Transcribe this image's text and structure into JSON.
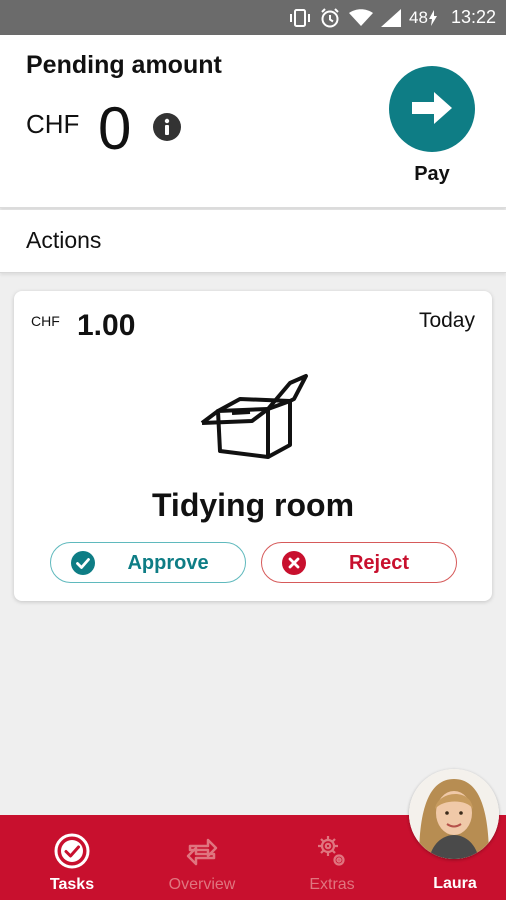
{
  "status_bar": {
    "battery": "48",
    "time": "13:22"
  },
  "header": {
    "title": "Pending amount",
    "currency": "CHF",
    "amount": "0",
    "pay_label": "Pay"
  },
  "actions": {
    "title": "Actions"
  },
  "task": {
    "currency": "CHF",
    "amount": "1.00",
    "date": "Today",
    "title": "Tidying room",
    "approve_label": "Approve",
    "reject_label": "Reject"
  },
  "nav": {
    "items": [
      {
        "label": "Tasks",
        "icon": "check-circle-icon",
        "active": true
      },
      {
        "label": "Overview",
        "icon": "transfer-arrows-icon",
        "active": false
      },
      {
        "label": "Extras",
        "icon": "gears-icon",
        "active": false
      }
    ],
    "profile_name": "Laura"
  },
  "colors": {
    "teal": "#0e7d85",
    "red": "#c8102e"
  }
}
